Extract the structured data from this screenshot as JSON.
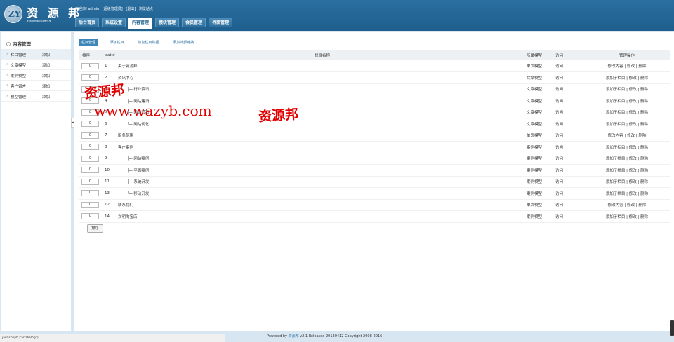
{
  "brand": {
    "title": "资 源 邦",
    "subtitle": "无限网资源与技术分享",
    "mark": "ZY"
  },
  "topbar": {
    "welcome": "欢迎你! admin",
    "role": "[超级管理员]",
    "logout": "[退出]",
    "visit_site": "浏览站点"
  },
  "nav": {
    "tabs": [
      "后台首页",
      "系统设置",
      "内容管理",
      "模块管理",
      "会员管理",
      "界面管理"
    ],
    "active_index": 2
  },
  "sidebar": {
    "heading": "内容管理",
    "items": [
      {
        "label": "栏目管理",
        "add": "添加"
      },
      {
        "label": "文章模型",
        "add": "添加"
      },
      {
        "label": "案例模型",
        "add": "添加"
      },
      {
        "label": "客户留言",
        "add": "添加"
      },
      {
        "label": "模型管理",
        "add": "添加"
      }
    ]
  },
  "subtabs": [
    "栏目管理",
    "添加栏目",
    "恢复栏目数据",
    "添加外部链接"
  ],
  "table": {
    "headers": {
      "order": "排序",
      "catid": "catid",
      "name": "栏目名称",
      "model": "所属模型",
      "access": "访问",
      "ops": "管理操作"
    },
    "rows": [
      {
        "order": "0",
        "catid": "1",
        "name": "关于资源邦",
        "model": "单页模型",
        "access": "访问",
        "ops": "修改内容 | 修改 | 删除"
      },
      {
        "order": "0",
        "catid": "2",
        "name": "资讯中心",
        "model": "文章模型",
        "access": "访问",
        "ops": "添加子栏目 | 修改 | 删除"
      },
      {
        "order": "0",
        "catid": "3",
        "name": "├─ 行业资讯",
        "model": "文章模型",
        "access": "访问",
        "ops": "添加子栏目 | 修改 | 删除"
      },
      {
        "order": "0",
        "catid": "4",
        "name": "├─ 网站建设",
        "model": "文章模型",
        "access": "访问",
        "ops": "添加子栏目 | 修改 | 删除"
      },
      {
        "order": "0",
        "catid": "5",
        "name": "├─ 网络营销",
        "model": "文章模型",
        "access": "访问",
        "ops": "添加子栏目 | 修改 | 删除"
      },
      {
        "order": "0",
        "catid": "6",
        "name": "└─ 网站优化",
        "model": "文章模型",
        "access": "访问",
        "ops": "添加子栏目 | 修改 | 删除"
      },
      {
        "order": "0",
        "catid": "7",
        "name": "服务范围",
        "model": "单页模型",
        "access": "访问",
        "ops": "修改内容 | 修改 | 删除"
      },
      {
        "order": "0",
        "catid": "8",
        "name": "客户案例",
        "model": "案例模型",
        "access": "访问",
        "ops": "添加子栏目 | 修改 | 删除"
      },
      {
        "order": "0",
        "catid": "9",
        "name": "├─ 网站案例",
        "model": "案例模型",
        "access": "访问",
        "ops": "添加子栏目 | 修改 | 删除"
      },
      {
        "order": "0",
        "catid": "10",
        "name": "├─ 平面案例",
        "model": "案例模型",
        "access": "访问",
        "ops": "添加子栏目 | 修改 | 删除"
      },
      {
        "order": "0",
        "catid": "11",
        "name": "├─ 系统开发",
        "model": "案例模型",
        "access": "访问",
        "ops": "添加子栏目 | 修改 | 删除"
      },
      {
        "order": "0",
        "catid": "13",
        "name": "└─ 移动开发",
        "model": "案例模型",
        "access": "访问",
        "ops": "添加子栏目 | 修改 | 删除"
      },
      {
        "order": "0",
        "catid": "12",
        "name": "联系我们",
        "model": "单页模型",
        "access": "访问",
        "ops": "修改内容 | 修改 | 删除"
      },
      {
        "order": "0",
        "catid": "14",
        "name": "文明淘宝店",
        "model": "案例模型",
        "access": "访问",
        "ops": "添加子栏目 | 修改 | 删除"
      }
    ],
    "sort_button": "排序"
  },
  "watermark": {
    "cn1": "资源邦",
    "url": "www.wazyb.com",
    "cn2": "资源邦",
    "color": "#e00000"
  },
  "statusbar": "javascript:;\"artDialog\");",
  "footer": {
    "prefix": "Powered by",
    "brand": "资源邦",
    "suffix": "v2.1 Released 20120412 Copyright 2008-2016"
  }
}
